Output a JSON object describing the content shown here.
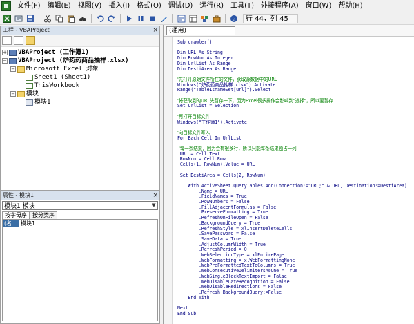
{
  "menu": {
    "items": [
      "文件(F)",
      "编辑(E)",
      "视图(V)",
      "插入(I)",
      "格式(O)",
      "调试(D)",
      "运行(R)",
      "工具(T)",
      "外接程序(A)",
      "窗口(W)",
      "帮助(H)"
    ]
  },
  "toolbar": {
    "cursor_position": "行 44，列 45"
  },
  "project_pane": {
    "title": "工程 - VBAProject",
    "close": "×",
    "tree": [
      {
        "label": "VBAProject (工作簿1)",
        "bold": true
      },
      {
        "label": "VBAProject (炉药药商品抽样.xlsx)",
        "bold": true
      },
      {
        "label": "Microsoft Excel 对象",
        "bold": false
      },
      {
        "label": "Sheet1 (Sheet1)",
        "bold": false
      },
      {
        "label": "ThisWorkbook",
        "bold": false
      },
      {
        "label": "模块",
        "bold": false
      },
      {
        "label": "模块1",
        "bold": false
      }
    ]
  },
  "properties_pane": {
    "title": "属性 - 模块1",
    "close": "×",
    "object": "模块1 模块",
    "tabs": [
      "按字母序",
      "按分类序"
    ],
    "rows": [
      {
        "key": "(名称)",
        "value": "模块1"
      }
    ]
  },
  "code_window": {
    "object_selector": "(通用)",
    "lines": [
      {
        "text": "Sub crawler()",
        "kind": "code"
      },
      {
        "text": "",
        "kind": "code"
      },
      {
        "text": "Dim URL As String",
        "kind": "code"
      },
      {
        "text": "Dim RowNum As Integer",
        "kind": "code"
      },
      {
        "text": "Dim UrlList As Range",
        "kind": "code"
      },
      {
        "text": "Dim DestiArea As Range",
        "kind": "code"
      },
      {
        "text": "",
        "kind": "code"
      },
      {
        "text": "'先打开原始文件所在的文件，获取源数据中的URL",
        "kind": "comment"
      },
      {
        "text": "Windows(\"炉药药商品抽样.xlsx\").Activate",
        "kind": "code"
      },
      {
        "text": "Range(\"Table1snameSet[url]\").Select",
        "kind": "code"
      },
      {
        "text": "",
        "kind": "code"
      },
      {
        "text": "'将获取到的URL先暂存一下，因为Excel很多操作会影响到\"选择\"，所以要暂存",
        "kind": "comment"
      },
      {
        "text": "Set UrlList = Selection",
        "kind": "code"
      },
      {
        "text": "",
        "kind": "code"
      },
      {
        "text": "'再打开目标文件",
        "kind": "comment"
      },
      {
        "text": "Windows(\"工作簿1\").Activate",
        "kind": "code"
      },
      {
        "text": "",
        "kind": "code"
      },
      {
        "text": "'向目标文件写入",
        "kind": "comment"
      },
      {
        "text": "For Each Cell In UrlList",
        "kind": "code"
      },
      {
        "text": "",
        "kind": "code"
      },
      {
        "text": " '每一条结果，因为会有很多行，所以只能每条结果独占一列",
        "kind": "comment"
      },
      {
        "text": " URL = Cell.Text",
        "kind": "code"
      },
      {
        "text": " RowNum = Cell.Row",
        "kind": "code"
      },
      {
        "text": " Cells(1, RowNum).Value = URL",
        "kind": "code"
      },
      {
        "text": "",
        "kind": "code"
      },
      {
        "text": " Set DestiArea = Cells(2, RowNum)",
        "kind": "code"
      },
      {
        "text": "",
        "kind": "code"
      },
      {
        "text": "    With ActiveSheet.QueryTables.Add(Connection:=\"URL;\" & URL, Destination:=DestiArea)",
        "kind": "code"
      },
      {
        "text": "        .Name = URL",
        "kind": "code"
      },
      {
        "text": "        .FieldNames = True",
        "kind": "code"
      },
      {
        "text": "        .RowNumbers = False",
        "kind": "code"
      },
      {
        "text": "        .FillAdjacentFormulas = False",
        "kind": "code"
      },
      {
        "text": "        .PreserveFormatting = True",
        "kind": "code"
      },
      {
        "text": "        .RefreshOnFileOpen = False",
        "kind": "code"
      },
      {
        "text": "        .BackgroundQuery = True",
        "kind": "code"
      },
      {
        "text": "        .RefreshStyle = xlInsertDeleteCells",
        "kind": "code"
      },
      {
        "text": "        .SavePassword = False",
        "kind": "code"
      },
      {
        "text": "        .SaveData = True",
        "kind": "code"
      },
      {
        "text": "        .AdjustColumnWidth = True",
        "kind": "code"
      },
      {
        "text": "        .RefreshPeriod = 0",
        "kind": "code"
      },
      {
        "text": "        .WebSelectionType = xlEntirePage",
        "kind": "code"
      },
      {
        "text": "        .WebFormatting = xlWebFormattingNone",
        "kind": "code"
      },
      {
        "text": "        .WebPreFormattedTextToColumns = True",
        "kind": "code"
      },
      {
        "text": "        .WebConsecutiveDelimitersAsOne = True",
        "kind": "code"
      },
      {
        "text": "        .WebSingleBlockTextImport = False",
        "kind": "code"
      },
      {
        "text": "        .WebDisableDateRecognition = False",
        "kind": "code"
      },
      {
        "text": "        .WebDisableRedirections = False",
        "kind": "code"
      },
      {
        "text": "        .Refresh BackgroundQuery:=False",
        "kind": "code"
      },
      {
        "text": "    End With",
        "kind": "code"
      },
      {
        "text": "",
        "kind": "code"
      },
      {
        "text": "Next",
        "kind": "code"
      },
      {
        "text": "End Sub",
        "kind": "code"
      }
    ]
  },
  "colors": {
    "keyword": "#0000a0",
    "comment": "#008000",
    "text": "#000080"
  }
}
